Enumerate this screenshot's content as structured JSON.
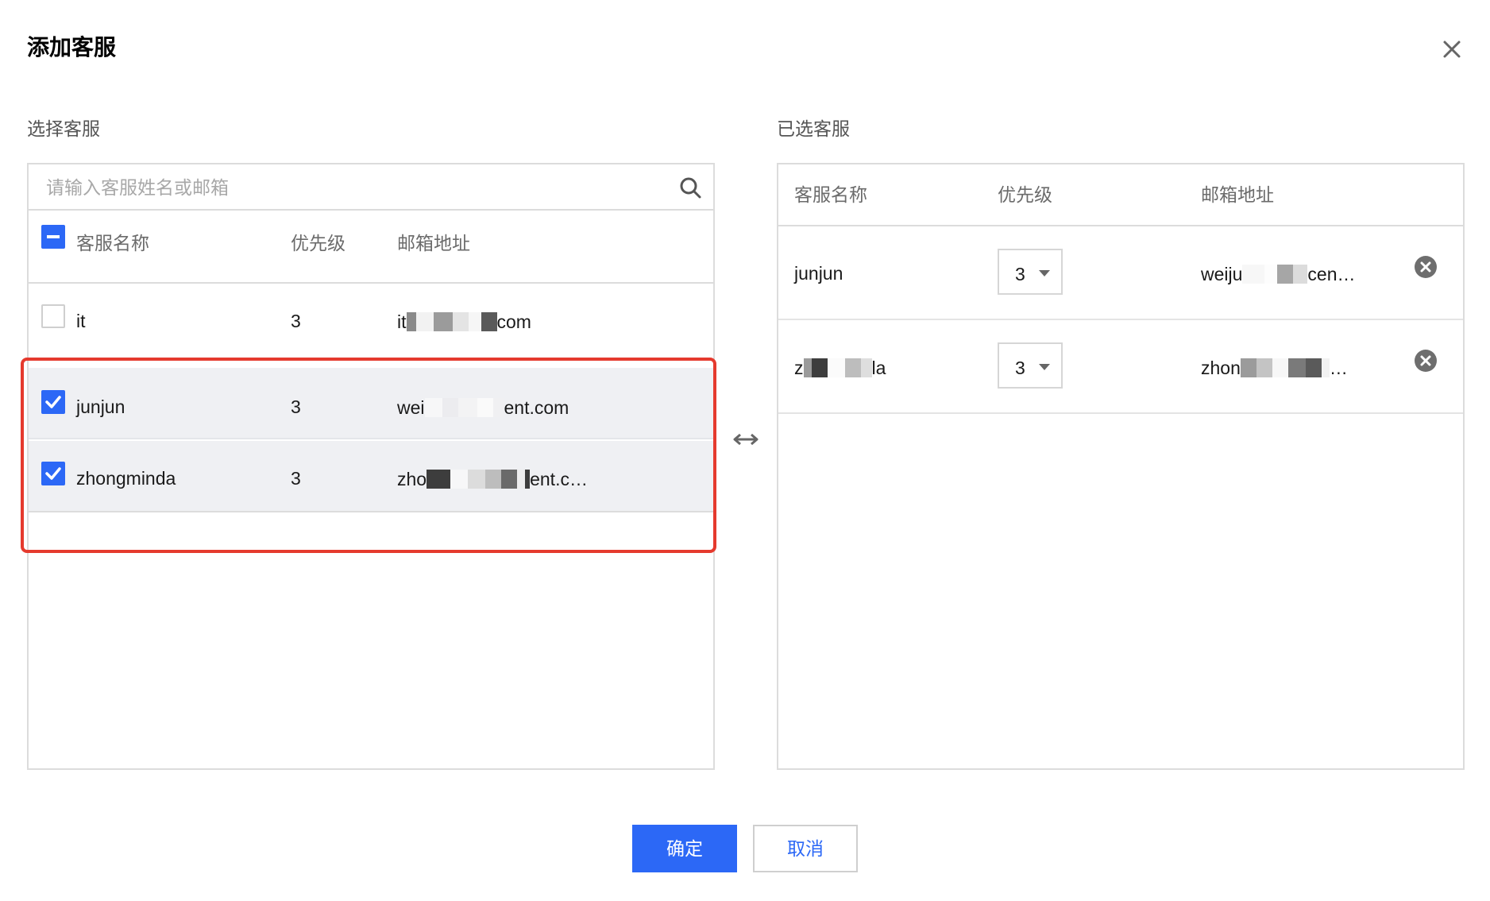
{
  "dialog": {
    "title": "添加客服",
    "close_icon": "close-icon"
  },
  "left": {
    "label": "选择客服",
    "search_placeholder": "请输入客服姓名或邮箱",
    "columns": {
      "name": "客服名称",
      "priority": "优先级",
      "email": "邮箱地址"
    },
    "select_all_state": "indeterminate",
    "rows": [
      {
        "name": "it",
        "priority": "3",
        "email_prefix": "it",
        "email_suffix": "com",
        "checked": false
      },
      {
        "name": "junjun",
        "priority": "3",
        "email_prefix": "wei",
        "email_suffix": "ent.com",
        "checked": true
      },
      {
        "name": "zhongminda",
        "priority": "3",
        "email_prefix": "zho",
        "email_suffix": "ent.c…",
        "checked": true
      }
    ]
  },
  "right": {
    "label": "已选客服",
    "columns": {
      "name": "客服名称",
      "priority": "优先级",
      "email": "邮箱地址"
    },
    "rows": [
      {
        "name_prefix": "junjun",
        "name_suffix": "",
        "priority": "3",
        "email_prefix": "weiju",
        "email_suffix": "cen…"
      },
      {
        "name_prefix": "z",
        "name_suffix": "la",
        "priority": "3",
        "email_prefix": "zhon",
        "email_suffix": "…"
      }
    ]
  },
  "footer": {
    "confirm": "确定",
    "cancel": "取消"
  },
  "colors": {
    "primary": "#2c68f6",
    "highlight_border": "#e53a2e",
    "selected_row_bg": "#eff0f3"
  }
}
